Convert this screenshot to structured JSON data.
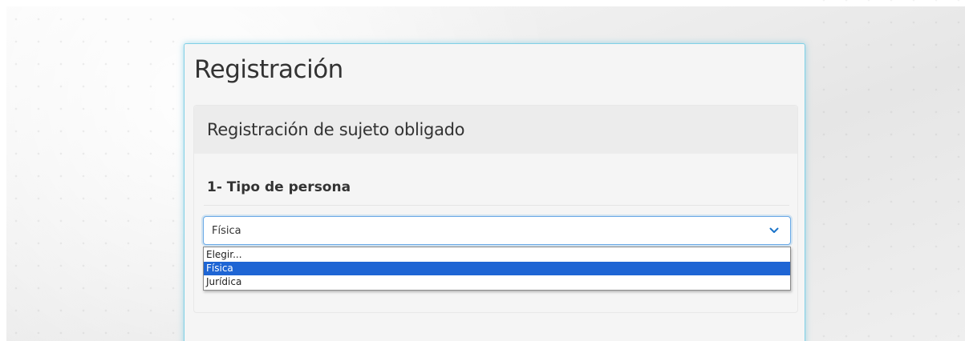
{
  "page": {
    "title": "Registración"
  },
  "panel": {
    "heading": "Registración de sujeto obligado",
    "section_title": "1- Tipo de persona"
  },
  "select": {
    "current_value": "Física",
    "options": [
      {
        "label": "Elegir...",
        "selected": false
      },
      {
        "label": "Física",
        "selected": true
      },
      {
        "label": "Jurídica",
        "selected": false
      }
    ]
  },
  "colors": {
    "card_border": "#80d0e6",
    "focus_border": "#6aa9e6",
    "selected_option_bg": "#1e65d4",
    "chevron": "#1a73c9"
  },
  "icons": {
    "select_arrow": "chevron-down-icon"
  }
}
